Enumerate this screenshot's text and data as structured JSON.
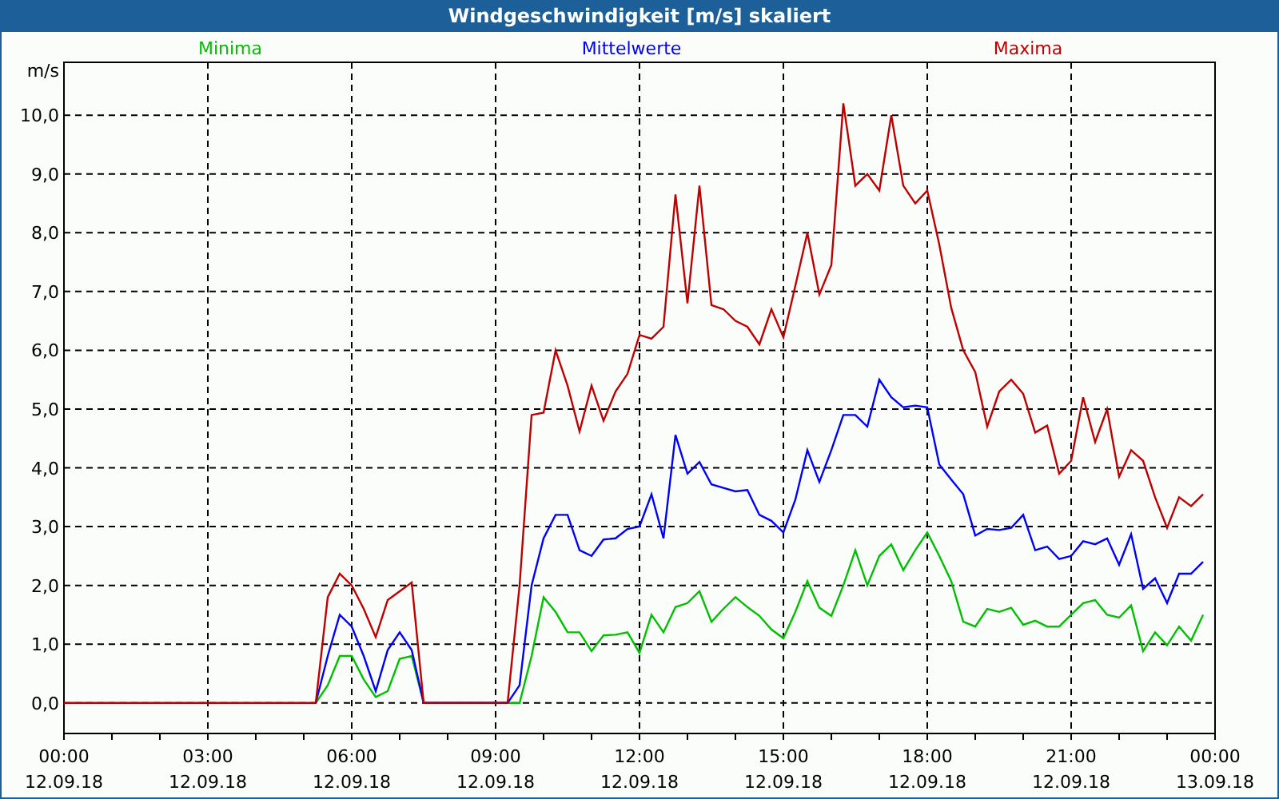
{
  "window": {
    "title": "Windgeschwindigkeit [m/s] skaliert"
  },
  "chart": {
    "chart_data": {
      "type": "line",
      "ylabel": "m/s",
      "categories": [
        "00:00\n12.09.18",
        null,
        null,
        null,
        null,
        null,
        null,
        null,
        null,
        null,
        null,
        null,
        "03:00\n12.09.18",
        null,
        null,
        null,
        null,
        null,
        null,
        null,
        null,
        null,
        null,
        null,
        "06:00\n12.09.18",
        null,
        null,
        null,
        null,
        null,
        null,
        null,
        null,
        null,
        null,
        null,
        "09:00\n12.09.18",
        null,
        null,
        null,
        null,
        null,
        null,
        null,
        null,
        null,
        null,
        null,
        "12:00\n12.09.18",
        null,
        null,
        null,
        null,
        null,
        null,
        null,
        null,
        null,
        null,
        null,
        "15:00\n12.09.18",
        null,
        null,
        null,
        null,
        null,
        null,
        null,
        null,
        null,
        null,
        null,
        "18:00\n12.09.18",
        null,
        null,
        null,
        null,
        null,
        null,
        null,
        null,
        null,
        null,
        null,
        "21:00\n12.09.18",
        null,
        null,
        null,
        null,
        null,
        null,
        null,
        null,
        null,
        null,
        null,
        "00:00\n13.09.18"
      ],
      "series": [
        {
          "name": "Minima",
          "color": "#00c000",
          "values": [
            null,
            null,
            null,
            null,
            null,
            null,
            null,
            null,
            null,
            null,
            null,
            null,
            null,
            null,
            null,
            null,
            null,
            null,
            null,
            null,
            null,
            0,
            0.3,
            0.8,
            0.8,
            0.4,
            0.1,
            0.2,
            0.75,
            0.8,
            0,
            0,
            0,
            0,
            0,
            0,
            0,
            0,
            0,
            0.8,
            1.8,
            1.55,
            1.2,
            1.2,
            0.88,
            1.15,
            1.16,
            1.2,
            0.85,
            1.5,
            1.2,
            1.63,
            1.7,
            1.9,
            1.38,
            1.6,
            1.8,
            1.63,
            1.48,
            1.25,
            1.1,
            1.55,
            2.07,
            1.62,
            1.48,
            2.0,
            2.6,
            2.0,
            2.5,
            2.7,
            2.26,
            2.6,
            2.9,
            2.5,
            2.07,
            1.38,
            1.3,
            1.6,
            1.55,
            1.62,
            1.33,
            1.4,
            1.3,
            1.3,
            1.5,
            1.7,
            1.75,
            1.5,
            1.45,
            1.66,
            0.88,
            1.2,
            0.98,
            1.3,
            1.06,
            1.5,
            null
          ]
        },
        {
          "name": "Mittelwerte",
          "color": "#0000ff",
          "values": [
            null,
            null,
            null,
            null,
            null,
            null,
            null,
            null,
            null,
            null,
            null,
            null,
            null,
            null,
            null,
            null,
            null,
            null,
            null,
            null,
            null,
            0,
            0.8,
            1.5,
            1.3,
            0.8,
            0.2,
            0.9,
            1.2,
            0.9,
            0,
            0,
            0,
            0,
            0,
            0,
            0,
            0,
            0.3,
            2.0,
            2.8,
            3.2,
            3.2,
            2.6,
            2.5,
            2.78,
            2.8,
            2.96,
            3.0,
            3.55,
            2.8,
            4.56,
            3.9,
            4.1,
            3.72,
            3.66,
            3.6,
            3.62,
            3.2,
            3.1,
            2.9,
            3.46,
            4.3,
            3.76,
            4.3,
            4.9,
            4.9,
            4.7,
            5.5,
            5.2,
            5.03,
            5.06,
            5.03,
            4.06,
            3.8,
            3.55,
            2.85,
            2.96,
            2.94,
            2.98,
            3.2,
            2.6,
            2.66,
            2.45,
            2.5,
            2.75,
            2.7,
            2.8,
            2.35,
            2.87,
            1.94,
            2.12,
            1.7,
            2.2,
            2.2,
            2.4,
            null
          ]
        },
        {
          "name": "Maxima",
          "color": "#c00000",
          "values": [
            0,
            0,
            0,
            0,
            0,
            0,
            0,
            0,
            0,
            0,
            0,
            0,
            0,
            0,
            0,
            0,
            0,
            0,
            0,
            0,
            0,
            0,
            1.8,
            2.2,
            2.0,
            1.6,
            1.12,
            1.75,
            1.9,
            2.05,
            0,
            0,
            0,
            0,
            0,
            0,
            0,
            0,
            2.0,
            4.9,
            4.94,
            6.0,
            5.4,
            4.62,
            5.4,
            4.8,
            5.3,
            5.6,
            6.26,
            6.2,
            6.4,
            8.65,
            6.8,
            8.8,
            6.77,
            6.7,
            6.5,
            6.4,
            6.1,
            6.7,
            6.22,
            7.1,
            8.0,
            6.95,
            7.45,
            10.2,
            8.8,
            9.0,
            8.72,
            10.0,
            8.8,
            8.5,
            8.72,
            7.8,
            6.72,
            6.0,
            5.63,
            4.7,
            5.3,
            5.5,
            5.26,
            4.6,
            4.72,
            3.9,
            4.12,
            5.2,
            4.44,
            5.0,
            3.85,
            4.3,
            4.12,
            3.5,
            2.98,
            3.5,
            3.35,
            3.55,
            null
          ]
        }
      ],
      "grid": true,
      "ylim": [
        -0.52,
        10.9
      ],
      "yticks": [
        {
          "value": 0,
          "label": "0,0"
        },
        {
          "value": 1,
          "label": "1,0"
        },
        {
          "value": 2,
          "label": "2,0"
        },
        {
          "value": 3,
          "label": "3,0"
        },
        {
          "value": 4,
          "label": "4,0"
        },
        {
          "value": 5,
          "label": "5,0"
        },
        {
          "value": 6,
          "label": "6,0"
        },
        {
          "value": 7,
          "label": "7,0"
        },
        {
          "value": 8,
          "label": "8,0"
        },
        {
          "value": 9,
          "label": "9,0"
        },
        {
          "value": 10,
          "label": "10,0"
        }
      ]
    }
  }
}
